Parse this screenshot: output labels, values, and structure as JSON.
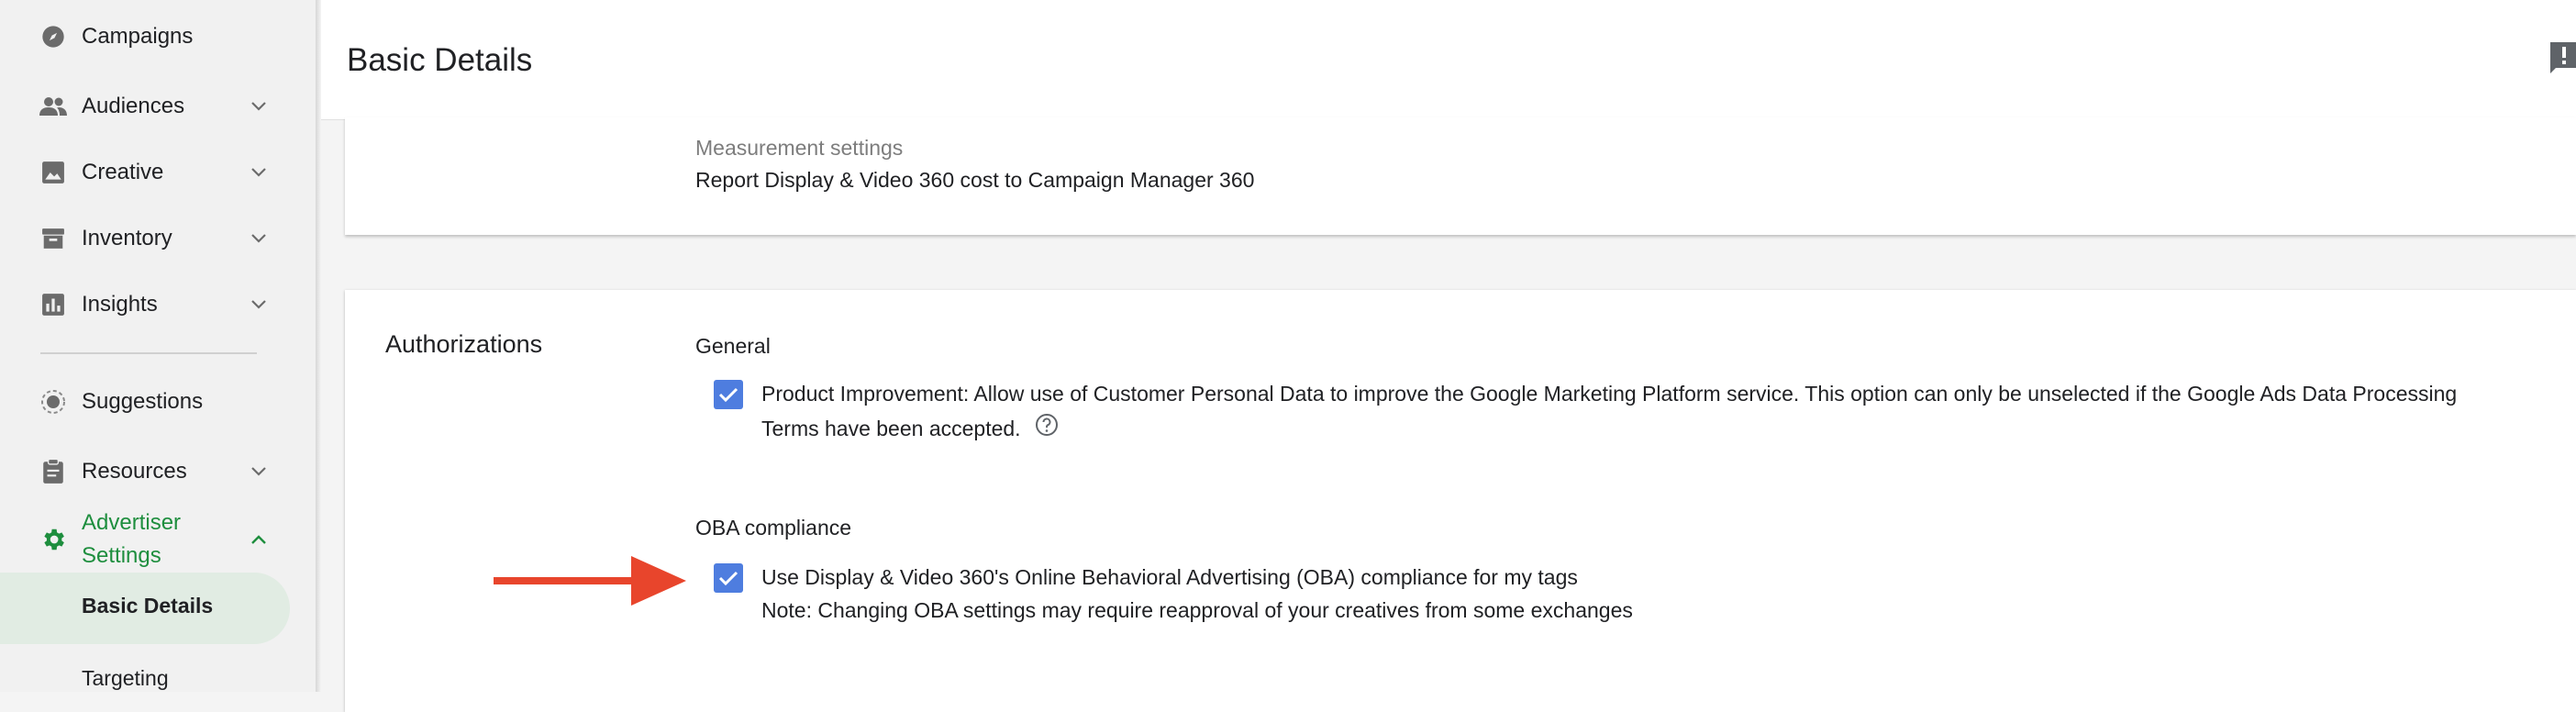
{
  "sidebar": {
    "items": [
      {
        "label": "Campaigns",
        "icon": "compass-icon",
        "chevron": false
      },
      {
        "label": "Audiences",
        "icon": "people-icon",
        "chevron": true
      },
      {
        "label": "Creative",
        "icon": "image-icon",
        "chevron": true
      },
      {
        "label": "Inventory",
        "icon": "archive-icon",
        "chevron": true
      },
      {
        "label": "Insights",
        "icon": "bar-chart-icon",
        "chevron": true
      },
      {
        "label": "Suggestions",
        "icon": "suggestions-icon",
        "chevron": false
      },
      {
        "label": "Resources",
        "icon": "clipboard-icon",
        "chevron": true
      }
    ],
    "active_section": {
      "label_line1": "Advertiser",
      "label_line2": "Settings",
      "icon": "gear-icon",
      "expanded": true
    },
    "subitems": [
      {
        "label": "Basic Details",
        "selected": true
      },
      {
        "label": "Targeting",
        "selected": false
      }
    ]
  },
  "header": {
    "title": "Basic Details",
    "feedback_icon": "feedback-icon"
  },
  "measurement": {
    "label": "Measurement settings",
    "value": "Report Display & Video 360 cost to Campaign Manager 360"
  },
  "authorizations": {
    "title": "Authorizations",
    "general": {
      "heading": "General",
      "checked": true,
      "text_line1": "Product Improvement: Allow use of Customer Personal Data to improve the Google Marketing Platform service. This option can only be unselected if the Google Ads Data Processing",
      "text_line2": "Terms have been accepted."
    },
    "oba": {
      "heading": "OBA compliance",
      "checked": true,
      "text_line1": "Use Display & Video 360's Online Behavioral Advertising (OBA) compliance for my tags",
      "text_line2": "Note: Changing OBA settings may require reapproval of your creatives from some exchanges"
    }
  },
  "colors": {
    "accent_green": "#1e8e3e",
    "checkbox_blue": "#4e7ddf",
    "annotation_red": "#e8452c"
  }
}
